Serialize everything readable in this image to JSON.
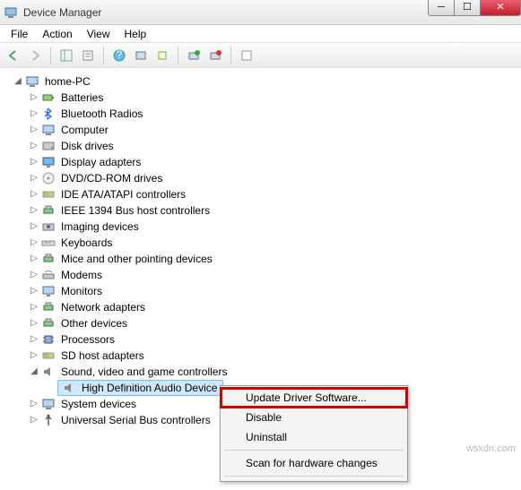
{
  "window": {
    "title": "Device Manager"
  },
  "menubar": {
    "file": "File",
    "action": "Action",
    "view": "View",
    "help": "Help"
  },
  "tree": {
    "root": "home-PC",
    "items": [
      "Batteries",
      "Bluetooth Radios",
      "Computer",
      "Disk drives",
      "Display adapters",
      "DVD/CD-ROM drives",
      "IDE ATA/ATAPI controllers",
      "IEEE 1394 Bus host controllers",
      "Imaging devices",
      "Keyboards",
      "Mice and other pointing devices",
      "Modems",
      "Monitors",
      "Network adapters",
      "Other devices",
      "Processors",
      "SD host adapters"
    ],
    "expanded_category": "Sound, video and game controllers",
    "selected_device": "High Definition Audio Device",
    "tail_items": [
      "System devices",
      "Universal Serial Bus controllers"
    ]
  },
  "context_menu": {
    "update": "Update Driver Software...",
    "disable": "Disable",
    "uninstall": "Uninstall",
    "scan": "Scan for hardware changes"
  },
  "watermark": "wsxdn.com"
}
